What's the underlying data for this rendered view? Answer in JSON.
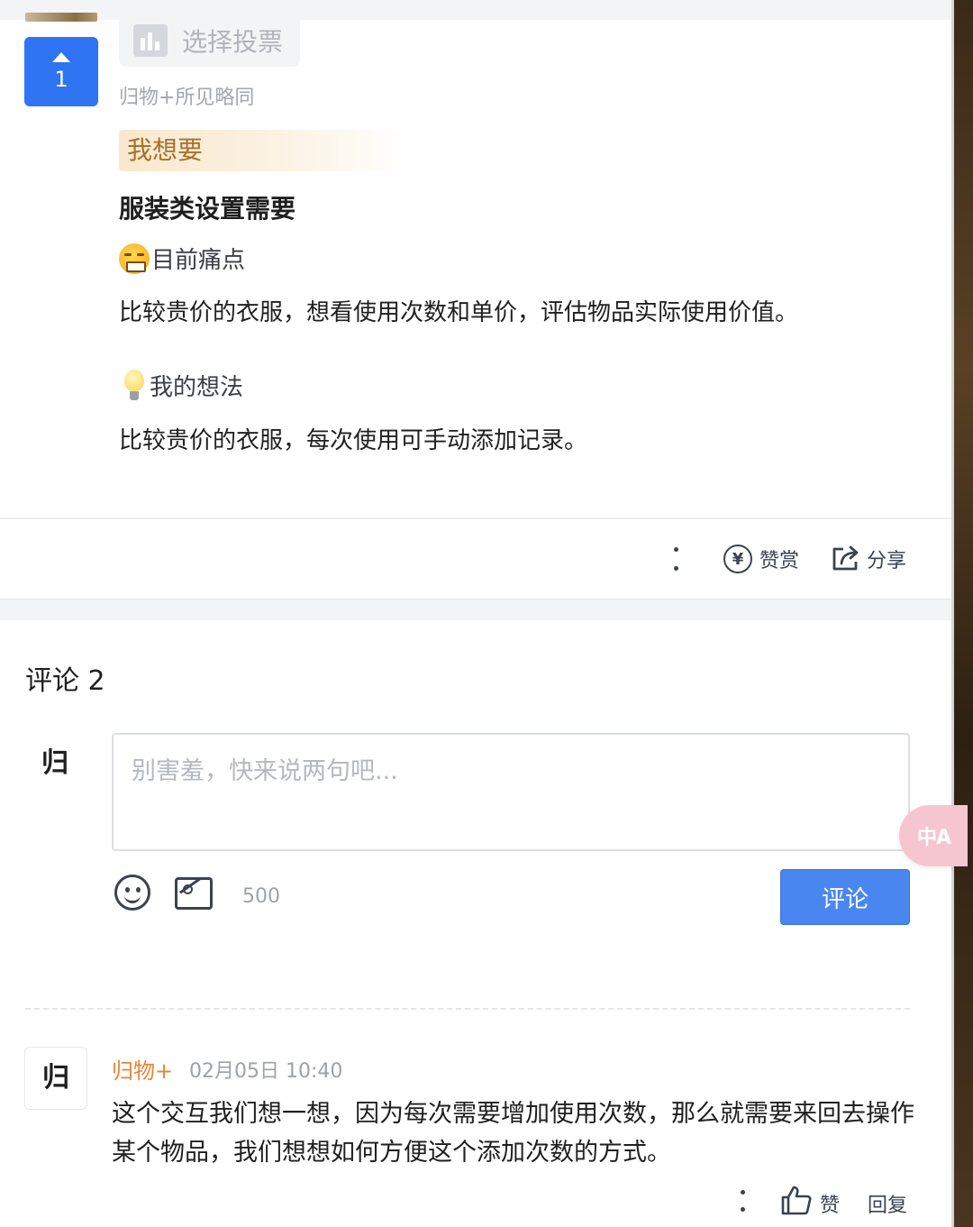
{
  "post": {
    "vote_count": "1",
    "poll_label": "选择投票",
    "category": "归物+所见略同",
    "tag": "我想要",
    "title": "服装类设置需要",
    "pain_heading": "目前痛点",
    "pain_text": "比较贵价的衣服，想看使用次数和单价，评估物品实际使用价值。",
    "idea_heading": "我的想法",
    "idea_text": "比较贵价的衣服，每次使用可手动添加记录。",
    "reward_label": "赞赏",
    "share_label": "分享"
  },
  "comments": {
    "title": "评论 2",
    "input_placeholder": "别害羞，快来说两句吧...",
    "char_count": "500",
    "submit_label": "评论",
    "avatar_glyph": "归",
    "items": [
      {
        "author": "归物+",
        "time": "02月05日 10:40",
        "text": "这个交互我们想一想，因为每次需要增加使用次数，那么就需要来回去操作某个物品，我们想想如何方便这个添加次数的方式。",
        "like_label": "赞",
        "reply_label": "回复"
      }
    ]
  },
  "translate_fab": "中A",
  "colors": {
    "accent": "#2f74f2",
    "button": "#4a86f0",
    "author": "#e8853a",
    "tag_text": "#a8702a"
  }
}
